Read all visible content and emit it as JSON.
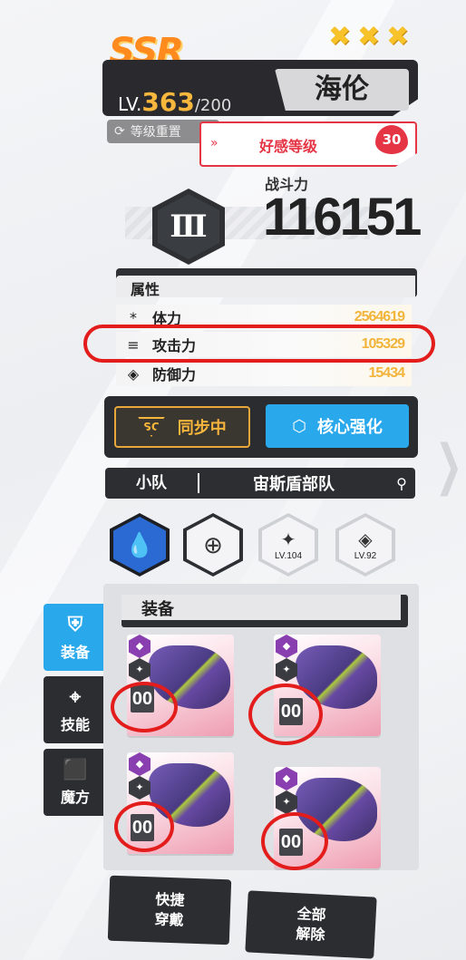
{
  "header": {
    "rarity": "SSR",
    "stars": [
      "✖",
      "✖",
      "✖"
    ],
    "level_prefix": "LV.",
    "level": "363",
    "level_max": "/200",
    "name": "海伦",
    "level_reset_label": "等级重置",
    "favor_label": "好感等级",
    "favor_level": "30"
  },
  "power": {
    "label": "战斗力",
    "value": "116151",
    "rank": "Ⅲ"
  },
  "attributes": {
    "title": "属性",
    "rows": [
      {
        "icon": "*",
        "label": "体力",
        "value": "2564619"
      },
      {
        "icon": "≡",
        "label": "攻击力",
        "value": "105329"
      },
      {
        "icon": "◈",
        "label": "防御力",
        "value": "15434"
      }
    ]
  },
  "sync": {
    "label": "同步中",
    "badge": "SC"
  },
  "core": {
    "label": "核心强化"
  },
  "team": {
    "label": "小队",
    "name": "宙斯盾部队"
  },
  "skills": [
    {
      "icon": "water-drop-icon",
      "level": ""
    },
    {
      "icon": "crosshair-icon",
      "level": ""
    },
    {
      "icon": "emblem-icon",
      "level": "LV.104"
    },
    {
      "icon": "emblem-icon",
      "level": "LV.92"
    }
  ],
  "side_tabs": [
    {
      "label": "装备",
      "active": true
    },
    {
      "label": "技能",
      "active": false
    },
    {
      "label": "魔方",
      "active": false
    }
  ],
  "equipment": {
    "title": "装备",
    "cards": [
      {
        "level": "00"
      },
      {
        "level": "00"
      },
      {
        "level": "00"
      },
      {
        "level": "00"
      }
    ]
  },
  "buttons": {
    "quick_equip": [
      "快捷",
      "穿戴"
    ],
    "unequip_all": [
      "全部",
      "解除"
    ]
  },
  "colors": {
    "accent_blue": "#29a8ec",
    "gold": "#f2b43a",
    "highlight_red": "#e31c1c",
    "favor_red": "#e53444"
  }
}
